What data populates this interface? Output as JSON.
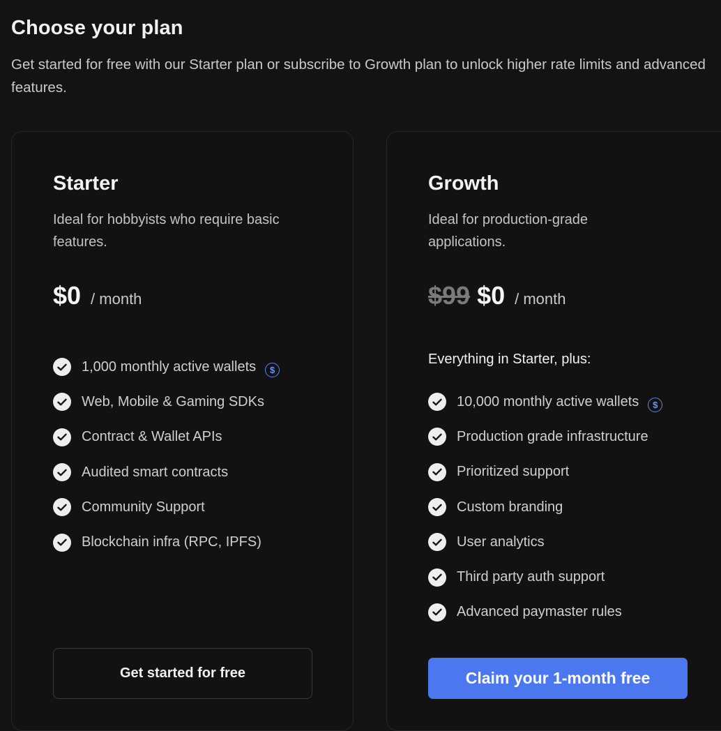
{
  "header": {
    "title": "Choose your plan",
    "subtitle": "Get started for free with our Starter plan or subscribe to Growth plan to unlock higher rate limits and advanced features."
  },
  "plans": [
    {
      "name": "Starter",
      "description": "Ideal for hobbyists who require basic features.",
      "price": "$0",
      "period": "/ month",
      "features": [
        {
          "label": "1,000 monthly active wallets",
          "info_icon": "dollar-circle-icon"
        },
        {
          "label": "Web, Mobile & Gaming SDKs"
        },
        {
          "label": "Contract & Wallet APIs"
        },
        {
          "label": "Audited smart contracts"
        },
        {
          "label": "Community Support"
        },
        {
          "label": "Blockchain infra (RPC, IPFS)"
        }
      ],
      "cta": "Get started for free"
    },
    {
      "name": "Growth",
      "description": "Ideal for production-grade applications.",
      "old_price": "$99",
      "price": "$0",
      "period": "/ month",
      "features_lead": "Everything in Starter, plus:",
      "features": [
        {
          "label": "10,000 monthly active wallets",
          "info_icon": "dollar-circle-icon"
        },
        {
          "label": "Production grade infrastructure"
        },
        {
          "label": "Prioritized support"
        },
        {
          "label": "Custom branding"
        },
        {
          "label": "User analytics"
        },
        {
          "label": "Third party auth support"
        },
        {
          "label": "Advanced paymaster rules"
        }
      ],
      "cta": "Claim your 1-month free"
    }
  ],
  "icons": {
    "check": "check-circle-icon",
    "dollar_symbol": "$"
  },
  "colors": {
    "background": "#131313",
    "accent": "#4c78ef",
    "info_icon": "#5b86f0"
  }
}
